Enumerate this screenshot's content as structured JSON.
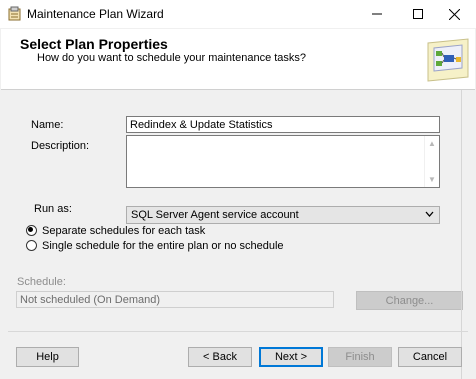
{
  "window": {
    "title": "Maintenance Plan Wizard",
    "icons": [
      "app-icon",
      "minimize-icon",
      "maximize-icon",
      "close-icon"
    ]
  },
  "header": {
    "title": "Select Plan Properties",
    "subtitle": "How do you want to schedule your maintenance tasks?"
  },
  "form": {
    "name_label": "Name:",
    "name_value": "Redindex & Update Statistics",
    "description_label": "Description:",
    "description_value": "",
    "run_as_label": "Run as:",
    "run_as_value": "SQL Server Agent service account",
    "schedule_options": [
      {
        "label": "Separate schedules for each task",
        "selected": true
      },
      {
        "label": "Single schedule for the entire plan or no schedule",
        "selected": false
      }
    ],
    "schedule_label": "Schedule:",
    "schedule_value": "Not scheduled (On Demand)",
    "change_button": "Change..."
  },
  "footer": {
    "help": "Help",
    "back": "< Back",
    "next": "Next >",
    "finish": "Finish",
    "cancel": "Cancel"
  }
}
